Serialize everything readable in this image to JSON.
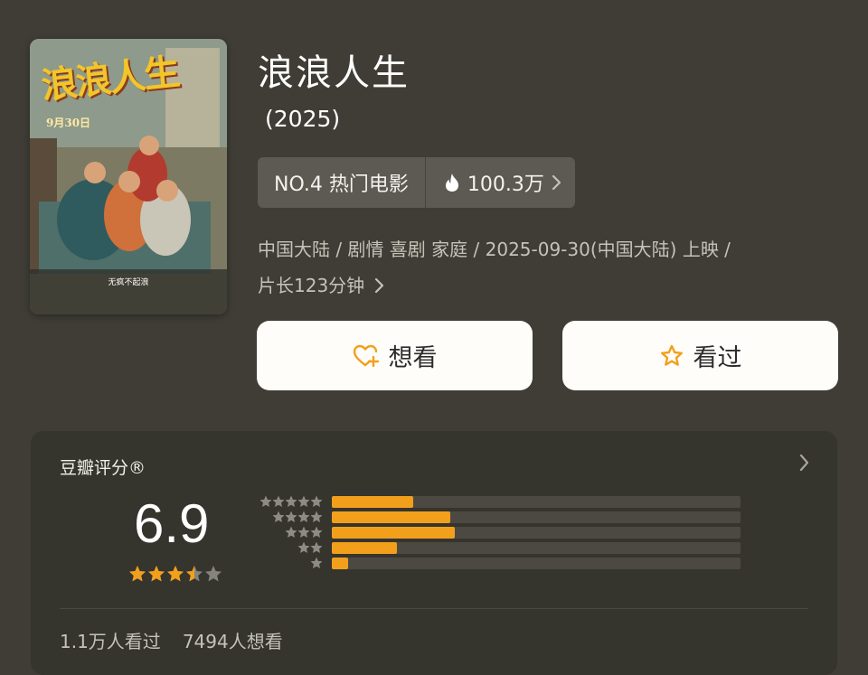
{
  "movie": {
    "title": "浪浪人生",
    "year": "(2025)",
    "rank": "NO.4 热门电影",
    "heat": "100.3万",
    "meta_line1": "中国大陆 / 剧情 喜剧 家庭 / 2025-09-30(中国大陆) 上映 /",
    "meta_line2": "片长123分钟"
  },
  "poster": {
    "title": "浪浪人生",
    "date": "9月30日",
    "tagline": "无疯不起浪"
  },
  "actions": {
    "want_label": "想看",
    "seen_label": "看过"
  },
  "rating": {
    "label": "豆瓣评分®",
    "score": "6.9",
    "stars_value": 3.5,
    "stars_max": 5,
    "distribution": [
      {
        "stars": 5,
        "fraction": 0.2
      },
      {
        "stars": 4,
        "fraction": 0.29
      },
      {
        "stars": 3,
        "fraction": 0.3
      },
      {
        "stars": 2,
        "fraction": 0.16
      },
      {
        "stars": 1,
        "fraction": 0.04
      }
    ],
    "seen_count": "1.1万人看过",
    "want_count": "7494人想看"
  },
  "colors": {
    "background": "#3f3d35",
    "card": "#35342d",
    "accent": "#f2a01c",
    "chip": "#5c5a52"
  },
  "icons": {
    "heat": "flame-icon",
    "want": "heart-plus-icon",
    "seen": "star-outline-icon"
  }
}
